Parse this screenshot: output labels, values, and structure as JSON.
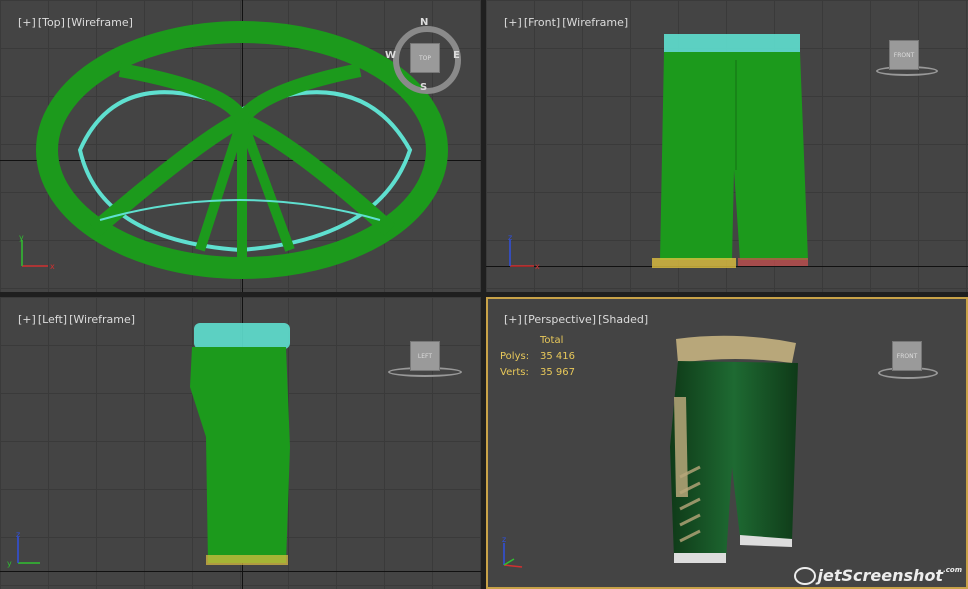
{
  "viewports": {
    "top": {
      "labels": [
        "[+]",
        "[Top]",
        "[Wireframe]"
      ],
      "cube_label": "TOP",
      "compass": {
        "n": "N",
        "s": "S",
        "e": "E",
        "w": "W"
      }
    },
    "front": {
      "labels": [
        "[+]",
        "[Front]",
        "[Wireframe]"
      ],
      "cube_label": "FRONT"
    },
    "left": {
      "labels": [
        "[+]",
        "[Left]",
        "[Wireframe]"
      ],
      "cube_label": "LEFT"
    },
    "perspective": {
      "labels": [
        "[+]",
        "[Perspective]",
        "[Shaded]"
      ],
      "cube_label": "FRONT",
      "stats": {
        "header": "Total",
        "polys_label": "Polys:",
        "polys": "35 416",
        "verts_label": "Verts:",
        "verts": "35 967"
      }
    }
  },
  "axis": {
    "x": "x",
    "y": "y",
    "z": "z"
  },
  "watermark": {
    "text": "jetScreenshot",
    "suffix": ".com"
  },
  "colors": {
    "wire_green": "#1c9a1c",
    "wire_cyan": "#5fe0d0",
    "shorts_green": "#1b5a2a",
    "shorts_gold": "#b8a77a",
    "active_border": "#c8a248"
  }
}
